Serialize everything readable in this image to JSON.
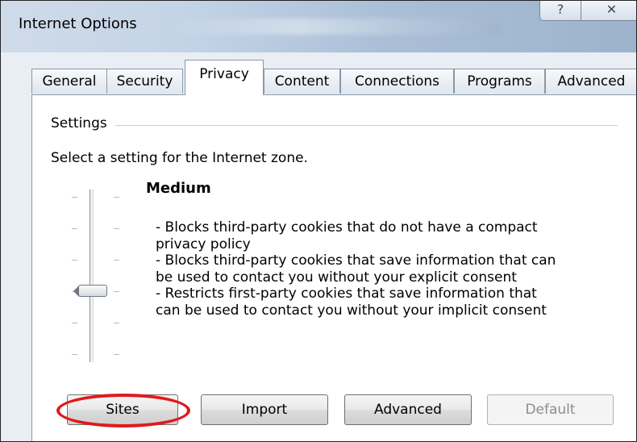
{
  "window": {
    "title": "Internet Options",
    "help_label": "?",
    "close_label": "✕"
  },
  "tabs": [
    {
      "label": "General",
      "active": false
    },
    {
      "label": "Security",
      "active": false
    },
    {
      "label": "Privacy",
      "active": true
    },
    {
      "label": "Content",
      "active": false
    },
    {
      "label": "Connections",
      "active": false
    },
    {
      "label": "Programs",
      "active": false
    },
    {
      "label": "Advanced",
      "active": false
    }
  ],
  "settings": {
    "group_label": "Settings",
    "zone_prompt": "Select a setting for the Internet zone.",
    "slider": {
      "level_name": "Medium",
      "level_index": 2,
      "level_count": 6
    },
    "description_lines": [
      "- Blocks third-party cookies that do not have a compact",
      "privacy policy",
      "- Blocks third-party cookies that save information that can",
      "be used to contact you without your explicit consent",
      "- Restricts first-party cookies that save information that",
      "can be used to contact you without your implicit consent"
    ]
  },
  "buttons": {
    "sites": {
      "label": "Sites",
      "enabled": true,
      "highlighted": true
    },
    "import": {
      "label": "Import",
      "enabled": true
    },
    "advanced": {
      "label": "Advanced",
      "enabled": true
    },
    "default": {
      "label": "Default",
      "enabled": false
    }
  },
  "colors": {
    "highlight_ring": "#e1191b"
  }
}
